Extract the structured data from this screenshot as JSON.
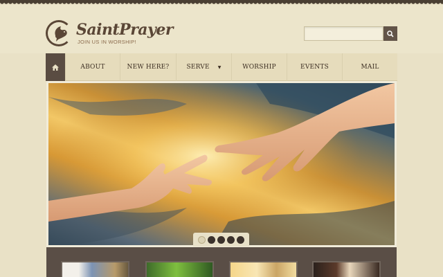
{
  "brand": {
    "name": "SaintPrayer",
    "tagline": "JOIN US IN WORSHIP!"
  },
  "search": {
    "placeholder": "",
    "button_icon": "magnifier-icon"
  },
  "nav": {
    "home_icon": "home-icon",
    "items": [
      {
        "label": "ABOUT"
      },
      {
        "label": "NEW HERE?"
      },
      {
        "label": "SERVE",
        "has_dropdown": true
      },
      {
        "label": "WORSHIP"
      },
      {
        "label": "EVENTS"
      },
      {
        "label": "MAIL"
      }
    ]
  },
  "slider": {
    "slide_count": 5,
    "active_index": 0
  },
  "colors": {
    "page_bg": "#e9e1c6",
    "brand_brown": "#5a4636",
    "nav_home_bg": "#5a4c42",
    "feature_bar_bg": "#5a4e46"
  }
}
